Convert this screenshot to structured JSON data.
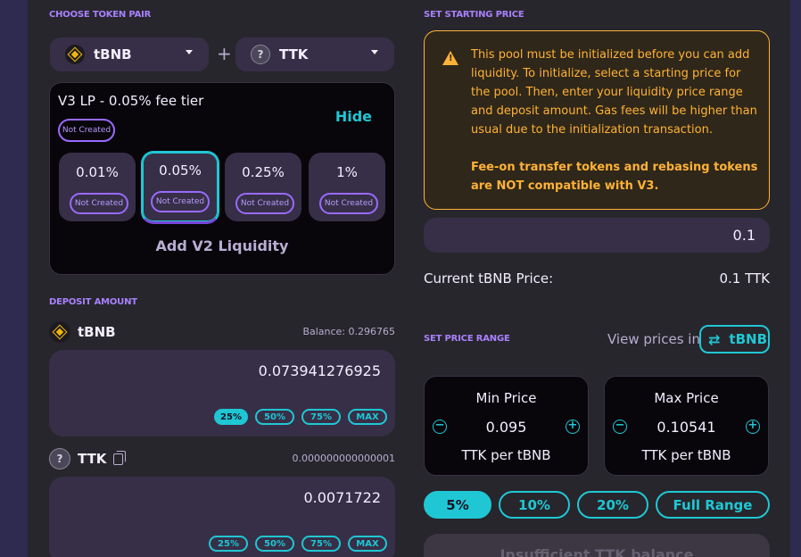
{
  "choose_pair": {
    "label": "CHOOSE TOKEN PAIR",
    "token_a": "tBNB",
    "token_b": "TTK"
  },
  "fee_card": {
    "title": "V3 LP - 0.05% fee tier",
    "status": "Not Created",
    "hide": "Hide",
    "tiers": [
      {
        "value": "0.01%",
        "status": "Not Created"
      },
      {
        "value": "0.05%",
        "status": "Not Created"
      },
      {
        "value": "0.25%",
        "status": "Not Created"
      },
      {
        "value": "1%",
        "status": "Not Created"
      }
    ],
    "selected_tier": "0.05%",
    "add_v2": "Add V2 Liquidity"
  },
  "deposit": {
    "label": "DEPOSIT AMOUNT",
    "token_a": {
      "name": "tBNB",
      "balance": "Balance: 0.296765",
      "amount": "0.073941276925",
      "pct": [
        "25%",
        "50%",
        "75%",
        "MAX"
      ],
      "active_pct": "25%"
    },
    "token_b": {
      "name": "TTK",
      "balance": "0.000000000000001",
      "amount": "0.0071722",
      "pct": [
        "25%",
        "50%",
        "75%",
        "MAX"
      ]
    }
  },
  "starting_price": {
    "label": "SET STARTING PRICE",
    "warning": "This pool must be initialized before you can add liquidity. To initialize, select a starting price for the pool. Then, enter your liquidity price range and deposit amount. Gas fees will be higher than usual due to the initialization transaction.",
    "warning_bold": "Fee-on transfer tokens and rebasing tokens are NOT compatible with V3.",
    "price_value": "0.1",
    "current_label": "Current tBNB Price:",
    "current_value": "0.1 TTK"
  },
  "price_range": {
    "label": "SET PRICE RANGE",
    "view_label": "View prices in",
    "view_token": "tBNB",
    "min": {
      "title": "Min Price",
      "value": "0.095",
      "unit": "TTK per tBNB"
    },
    "max": {
      "title": "Max Price",
      "value": "0.10541",
      "unit": "TTK per tBNB"
    },
    "buttons": [
      "5%",
      "10%",
      "20%",
      "Full Range"
    ],
    "active_button": "5%",
    "submit": "Insufficient TTK balance"
  },
  "colors": {
    "accent": "#1fc7d4",
    "purple": "#a881fc",
    "warning": "#ffb237",
    "card": "#372f47"
  }
}
